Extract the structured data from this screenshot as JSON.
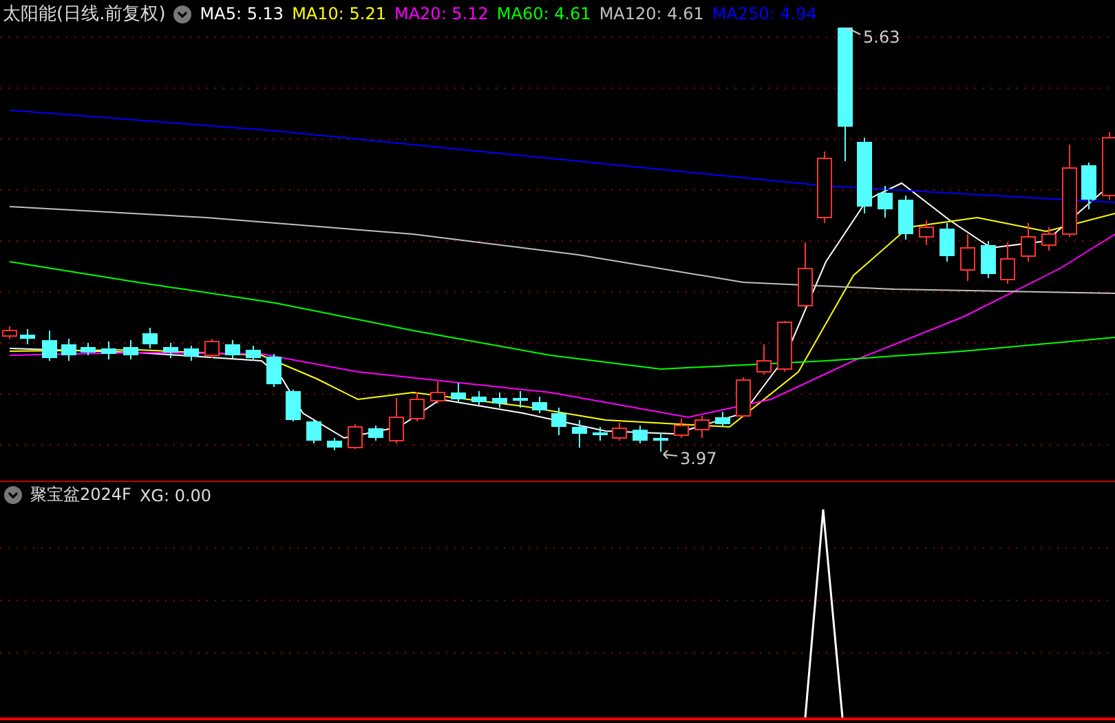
{
  "chart_header": {
    "title": "太阳能(日线.前复权)",
    "moving_averages": [
      {
        "label": "MA5:",
        "value": "5.13",
        "color": "#ffffff"
      },
      {
        "label": "MA10:",
        "value": "5.21",
        "color": "#ffff00"
      },
      {
        "label": "MA20:",
        "value": "5.12",
        "color": "#ff00ff"
      },
      {
        "label": "MA60:",
        "value": "4.61",
        "color": "#00ff00"
      },
      {
        "label": "MA120:",
        "value": "4.61",
        "color": "#c0c0c0"
      },
      {
        "label": "MA250:",
        "value": "4.94",
        "color": "#0000ff"
      }
    ]
  },
  "price_markers": {
    "high": "5.63",
    "low": "3.97"
  },
  "indicator_header": {
    "name": "聚宝盆2024F",
    "reading": "XG: 0.00"
  }
}
